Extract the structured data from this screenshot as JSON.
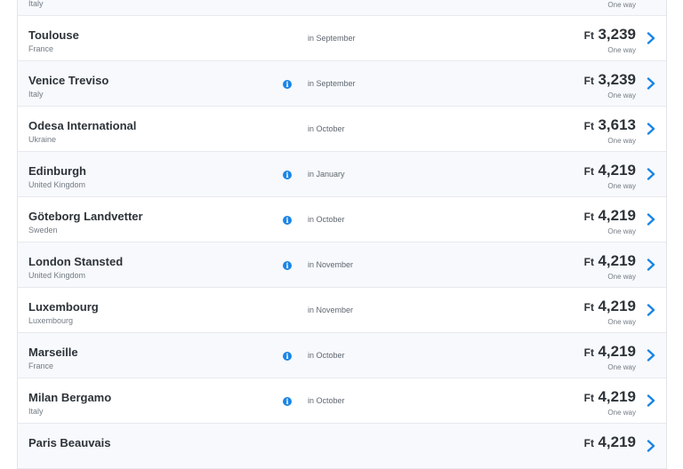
{
  "currency": "Ft",
  "destinations": [
    {
      "city": "",
      "country": "Italy",
      "month": "",
      "price": "",
      "trip_type": "One way",
      "info": false
    },
    {
      "city": "Toulouse",
      "country": "France",
      "month": "in September",
      "price": "3,239",
      "trip_type": "One way",
      "info": false
    },
    {
      "city": "Venice Treviso",
      "country": "Italy",
      "month": "in September",
      "price": "3,239",
      "trip_type": "One way",
      "info": true
    },
    {
      "city": "Odesa International",
      "country": "Ukraine",
      "month": "in October",
      "price": "3,613",
      "trip_type": "One way",
      "info": false
    },
    {
      "city": "Edinburgh",
      "country": "United Kingdom",
      "month": "in January",
      "price": "4,219",
      "trip_type": "One way",
      "info": true
    },
    {
      "city": "Göteborg Landvetter",
      "country": "Sweden",
      "month": "in October",
      "price": "4,219",
      "trip_type": "One way",
      "info": true
    },
    {
      "city": "London Stansted",
      "country": "United Kingdom",
      "month": "in November",
      "price": "4,219",
      "trip_type": "One way",
      "info": true
    },
    {
      "city": "Luxembourg",
      "country": "Luxembourg",
      "month": "in November",
      "price": "4,219",
      "trip_type": "One way",
      "info": false
    },
    {
      "city": "Marseille",
      "country": "France",
      "month": "in October",
      "price": "4,219",
      "trip_type": "One way",
      "info": true
    },
    {
      "city": "Milan Bergamo",
      "country": "Italy",
      "month": "in October",
      "price": "4,219",
      "trip_type": "One way",
      "info": true
    },
    {
      "city": "Paris Beauvais",
      "country": "",
      "month": "",
      "price": "4,219",
      "trip_type": "",
      "info": false
    }
  ],
  "icons": {
    "info": "info-icon",
    "chevron": "chevron-right-icon"
  },
  "colors": {
    "accent": "#1a85e6",
    "row_alt": "#f7f9fc",
    "border": "#e6e9ee"
  }
}
